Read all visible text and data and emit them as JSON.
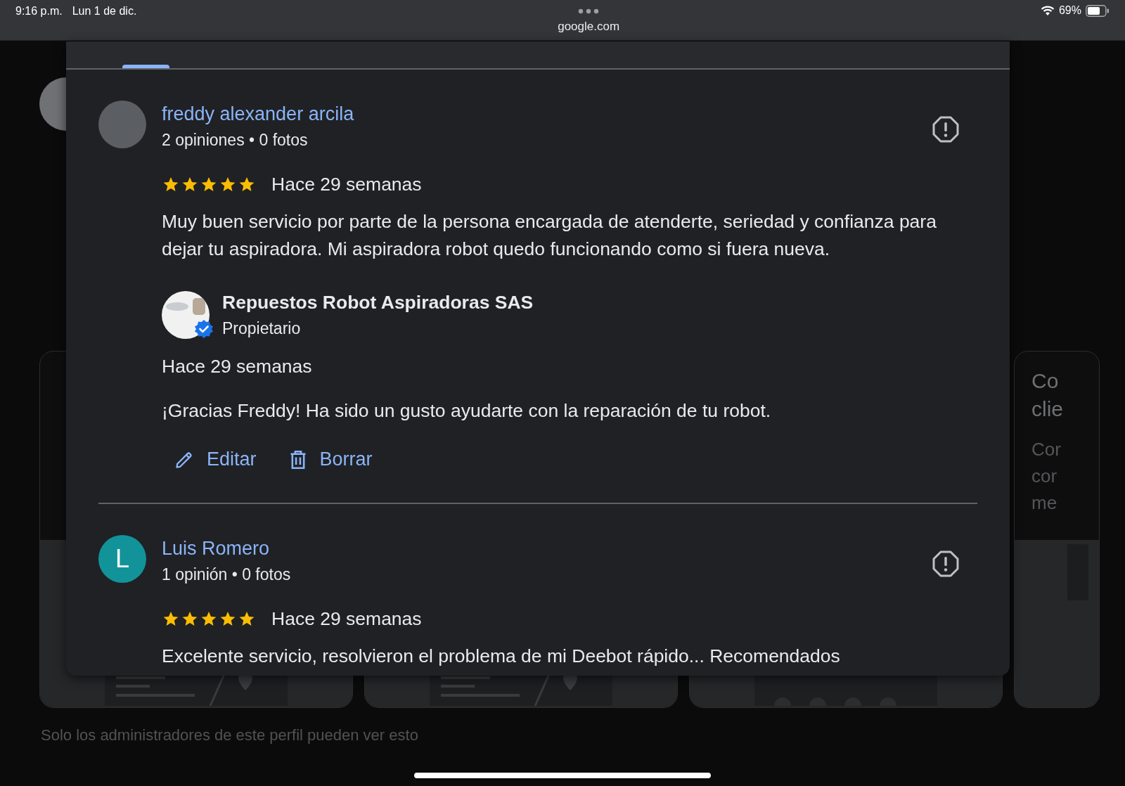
{
  "status_bar": {
    "time": "9:16 p.m.",
    "date": "Lun 1 de dic.",
    "url": "google.com",
    "battery": "69%"
  },
  "background": {
    "cards": [
      {
        "kind": "map"
      },
      {
        "kind": "map"
      },
      {
        "kind": "dots"
      },
      {
        "kind": "panel",
        "title": [
          "Co",
          "clie"
        ],
        "body": [
          "Cor",
          "cor",
          "me"
        ]
      }
    ],
    "footer": "Solo los administradores de este perfil pueden ver esto"
  },
  "reviews": [
    {
      "author": "freddy alexander arcila",
      "avatar": {
        "kind": "photo"
      },
      "meta": "2 opiniones • 0 fotos",
      "stars": 5,
      "time": "Hace 29 semanas",
      "text": "Muy buen servicio por parte de la persona encargada de atenderte, seriedad y confianza para dejar tu aspiradora. Mi aspiradora robot quedo funcionando como si fuera nueva.",
      "reply": {
        "name": "Repuestos Robot Aspiradoras SAS",
        "role": "Propietario",
        "verified": true,
        "time": "Hace 29 semanas",
        "text": "¡Gracias Freddy! Ha sido un gusto ayudarte con la reparación de tu robot.",
        "actions": [
          {
            "kind": "edit",
            "label": "Editar"
          },
          {
            "kind": "delete",
            "label": "Borrar"
          }
        ]
      }
    },
    {
      "author": "Luis Romero",
      "avatar": {
        "kind": "letter",
        "letter": "L",
        "color": "#12939a"
      },
      "meta": "1 opinión • 0 fotos",
      "stars": 5,
      "time": "Hace 29 semanas",
      "text": "Excelente servicio, resolvieron el problema de mi Deebot rápido... Recomendados"
    }
  ]
}
